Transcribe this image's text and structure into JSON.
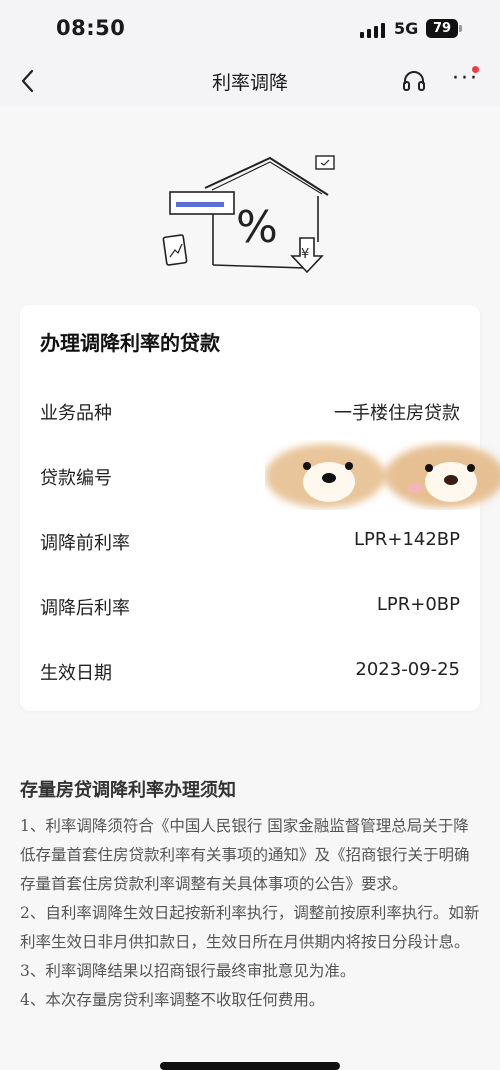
{
  "status_bar": {
    "time": "08:50",
    "network": "5G",
    "battery": "79"
  },
  "nav": {
    "title": "利率调降",
    "back_icon": "chevron-left-icon",
    "support_icon": "headset-icon",
    "more_icon": "more-dots-icon",
    "more_label": "···"
  },
  "hero": {
    "percent": "%",
    "yen": "¥"
  },
  "card": {
    "title": "办理调降利率的贷款",
    "rows": [
      {
        "label": "业务品种",
        "value": "一手楼住房贷款"
      },
      {
        "label": "贷款编号",
        "value": ""
      },
      {
        "label": "调降前利率",
        "value": "LPR+142BP"
      },
      {
        "label": "调降后利率",
        "value": "LPR+0BP"
      },
      {
        "label": "生效日期",
        "value": "2023-09-25"
      }
    ]
  },
  "notice": {
    "title": "存量房贷调降利率办理须知",
    "items": [
      "1、利率调降须符合《中国人民银行 国家金融监督管理总局关于降低存量首套住房贷款利率有关事项的通知》及《招商银行关于明确存量首套住房贷款利率调整有关具体事项的公告》要求。",
      "2、自利率调降生效日起按新利率执行，调整前按原利率执行。如新利率生效日非月供扣款日，生效日所在月供期内将按日分段计息。",
      "3、利率调降结果以招商银行最终审批意见为准。",
      "4、本次存量房贷利率调整不收取任何费用。"
    ]
  },
  "colors": {
    "accent_red": "#e8413e",
    "page_bg": "#f7f7f8"
  }
}
